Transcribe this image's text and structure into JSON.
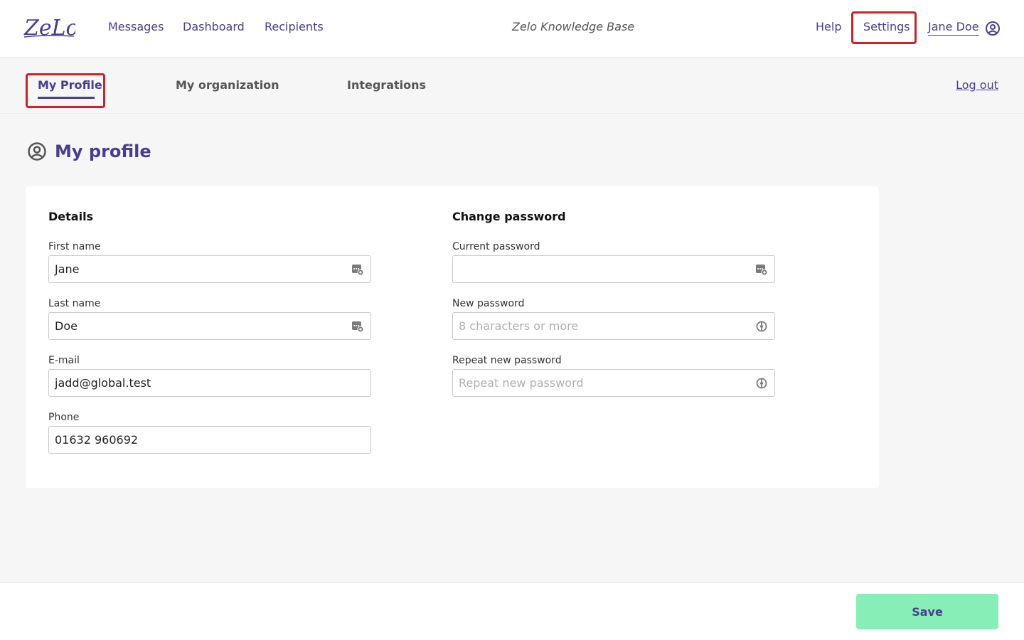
{
  "brand": {
    "logo_text": "ZeLo",
    "color": "#4a3d8f"
  },
  "header": {
    "nav": {
      "messages": "Messages",
      "dashboard": "Dashboard",
      "recipients": "Recipients"
    },
    "knowledge_base": "Zelo Knowledge Base",
    "help": "Help",
    "settings": "Settings",
    "user_name": "Jane Doe",
    "user_icon": "user-circle-icon"
  },
  "subnav": {
    "tabs": {
      "my_profile": "My Profile",
      "my_organization": "My organization",
      "integrations": "Integrations"
    },
    "active_tab": "My Profile",
    "logout": "Log out"
  },
  "page": {
    "title": "My profile",
    "title_icon": "user-circle-icon"
  },
  "details": {
    "title": "Details",
    "first_name": {
      "label": "First name",
      "value": "Jane",
      "icon": "password-manager-icon"
    },
    "last_name": {
      "label": "Last name",
      "value": "Doe",
      "icon": "password-manager-icon"
    },
    "email": {
      "label": "E-mail",
      "value": "jadd@global.test"
    },
    "phone": {
      "label": "Phone",
      "value": "01632 960692"
    }
  },
  "password": {
    "title": "Change password",
    "current": {
      "label": "Current password",
      "value": "",
      "icon": "password-manager-icon"
    },
    "new": {
      "label": "New password",
      "placeholder": "8 characters or more",
      "icon": "password-generator-icon"
    },
    "repeat": {
      "label": "Repeat new password",
      "placeholder": "Repeat new password",
      "icon": "password-generator-icon"
    }
  },
  "footer": {
    "save": "Save",
    "save_color": "#86eeb6"
  },
  "highlight_color": "#d0202a"
}
